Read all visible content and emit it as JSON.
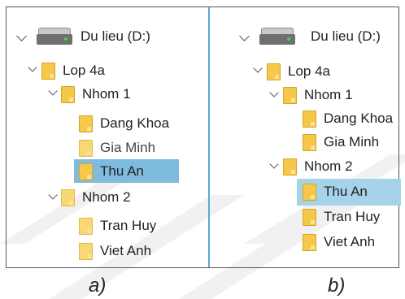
{
  "panel_a": {
    "drive_label": "Du lieu (D:)",
    "class_folder": "Lop 4a",
    "group1": "Nhom 1",
    "group1_items": [
      "Dang Khoa",
      "Gia Minh",
      "Thu An"
    ],
    "group2": "Nhom 2",
    "group2_items": [
      "Tran Huy",
      "Viet Anh"
    ],
    "caption": "a)"
  },
  "panel_b": {
    "drive_label": "Du lieu (D:)",
    "class_folder": "Lop 4a",
    "group1": "Nhom 1",
    "group1_items": [
      "Dang Khoa",
      "Gia Minh"
    ],
    "group2": "Nhom 2",
    "group2_items": [
      "Thu An",
      "Tran Huy",
      "Viet Anh"
    ],
    "caption": "b)"
  },
  "colors": {
    "selection_a": "#7fbadf",
    "selection_b": "#a6d3ea",
    "folder": "#f6c84a",
    "divider": "#5aa8d0"
  }
}
